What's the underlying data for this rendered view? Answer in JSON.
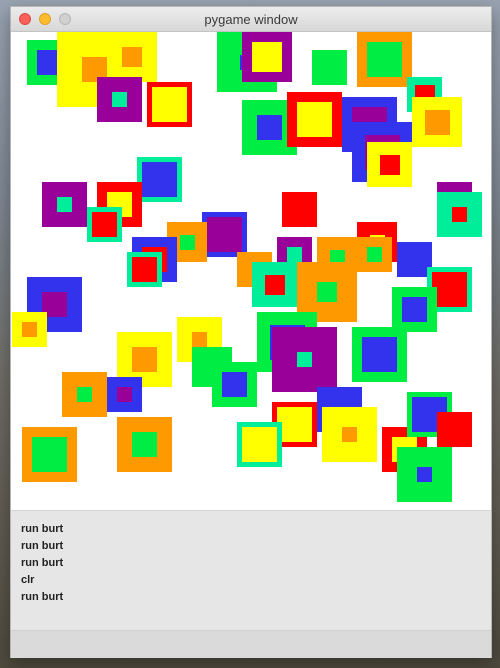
{
  "window": {
    "title": "pygame window"
  },
  "console": {
    "lines": [
      "run burt",
      "run burt",
      "run burt",
      "clr",
      "run burt"
    ]
  },
  "colors": {
    "green": "#00ee44",
    "blue": "#3333ee",
    "purple": "#990099",
    "yellow": "#ffff00",
    "orange": "#ff9900",
    "red": "#ff0000",
    "teal": "#00ee99"
  }
}
